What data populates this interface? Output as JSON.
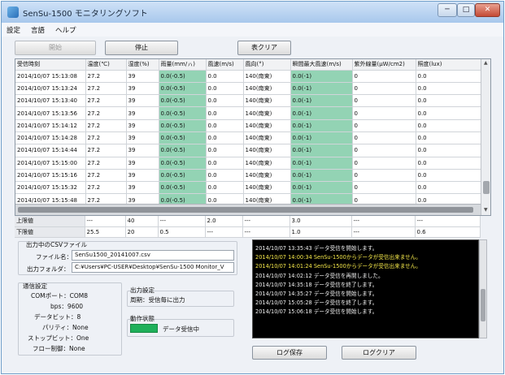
{
  "window": {
    "title": "SenSu-1500 モニタリングソフト",
    "controls": {
      "minimize": "─",
      "maximize": "□",
      "close": "✕"
    }
  },
  "menu": [
    "設定",
    "言語",
    "ヘルプ"
  ],
  "toolbar": {
    "start": "開始",
    "stop": "停止",
    "clear": "表クリア"
  },
  "table": {
    "columns": [
      "受信時刻",
      "温度(℃)",
      "湿度(%)",
      "雨量(mm/ㇵ)",
      "風速(m/s)",
      "風向(°)",
      "瞬間最大風速(m/s)",
      "紫外線量(μW/cm2)",
      "照度(lux)"
    ],
    "rows": [
      [
        "2014/10/07 15:13:08",
        "27.2",
        "39",
        "0.0(-0.5)",
        "0.0",
        "140(南東)",
        "0.0(-1)",
        "0",
        "0.0"
      ],
      [
        "2014/10/07 15:13:24",
        "27.2",
        "39",
        "0.0(-0.5)",
        "0.0",
        "140(南東)",
        "0.0(-1)",
        "0",
        "0.0"
      ],
      [
        "2014/10/07 15:13:40",
        "27.2",
        "39",
        "0.0(-0.5)",
        "0.0",
        "140(南東)",
        "0.0(-1)",
        "0",
        "0.0"
      ],
      [
        "2014/10/07 15:13:56",
        "27.2",
        "39",
        "0.0(-0.5)",
        "0.0",
        "140(南東)",
        "0.0(-1)",
        "0",
        "0.0"
      ],
      [
        "2014/10/07 15:14:12",
        "27.2",
        "39",
        "0.0(-0.5)",
        "0.0",
        "140(南東)",
        "0.0(-1)",
        "0",
        "0.0"
      ],
      [
        "2014/10/07 15:14:28",
        "27.2",
        "39",
        "0.0(-0.5)",
        "0.0",
        "140(南東)",
        "0.0(-1)",
        "0",
        "0.0"
      ],
      [
        "2014/10/07 15:14:44",
        "27.2",
        "39",
        "0.0(-0.5)",
        "0.0",
        "140(南東)",
        "0.0(-1)",
        "0",
        "0.0"
      ],
      [
        "2014/10/07 15:15:00",
        "27.2",
        "39",
        "0.0(-0.5)",
        "0.0",
        "140(南東)",
        "0.0(-1)",
        "0",
        "0.0"
      ],
      [
        "2014/10/07 15:15:16",
        "27.2",
        "39",
        "0.0(-0.5)",
        "0.0",
        "140(南東)",
        "0.0(-1)",
        "0",
        "0.0"
      ],
      [
        "2014/10/07 15:15:32",
        "27.2",
        "39",
        "0.0(-0.5)",
        "0.0",
        "140(南東)",
        "0.0(-1)",
        "0",
        "0.0"
      ],
      [
        "2014/10/07 15:15:48",
        "27.2",
        "39",
        "0.0(-0.5)",
        "0.0",
        "140(南東)",
        "0.0(-1)",
        "0",
        "0.0"
      ]
    ]
  },
  "limits": {
    "upper": [
      "上限値",
      "---",
      "40",
      "---",
      "2.0",
      "---",
      "3.0",
      "---",
      "---"
    ],
    "lower": [
      "下限値",
      "25.5",
      "20",
      "0.5",
      "---",
      "---",
      "1.0",
      "---",
      "0.6"
    ]
  },
  "output": {
    "group_label": "出力中のCSVファイル",
    "file_label": "ファイル名：",
    "file_value": "SenSu1500_20141007.csv",
    "folder_label": "出力フォルダ：",
    "folder_value": "C:¥Users¥PC-USER¥Desktop¥SenSu-1500 Monitor_V"
  },
  "comm": {
    "group_label": "通信設定",
    "items": [
      "COMポート：COM8",
      "bps：9600",
      "データビット：8",
      "パリティ：None",
      "ストップビット：One",
      "フロー制御：None"
    ]
  },
  "output_setting": {
    "group_label": "出力設定",
    "value": "周期：受信毎に出力"
  },
  "status": {
    "group_label": "動作状態",
    "value": "データ受信中",
    "color": "#1fb05a"
  },
  "log": [
    {
      "time": "2014/10/07 13:35:43",
      "msg": "データ受信を開始します。"
    },
    {
      "time": "2014/10/07 14:00:34",
      "msg": "SenSu-1500からデータが受信出来ません。"
    },
    {
      "time": "2014/10/07 14:01:24",
      "msg": "SenSu-1500からデータが受信出来ません。"
    },
    {
      "time": "2014/10/07 14:02:12",
      "msg": "データ受信を再開しました。"
    },
    {
      "time": "2014/10/07 14:35:18",
      "msg": "データ受信を終了します。"
    },
    {
      "time": "2014/10/07 14:35:27",
      "msg": "データ受信を開始します。"
    },
    {
      "time": "2014/10/07 15:05:28",
      "msg": "データ受信を終了します。"
    },
    {
      "time": "2014/10/07 15:06:18",
      "msg": "データ受信を開始します。"
    }
  ],
  "log_buttons": {
    "save": "ログ保存",
    "clear": "ログクリア"
  }
}
